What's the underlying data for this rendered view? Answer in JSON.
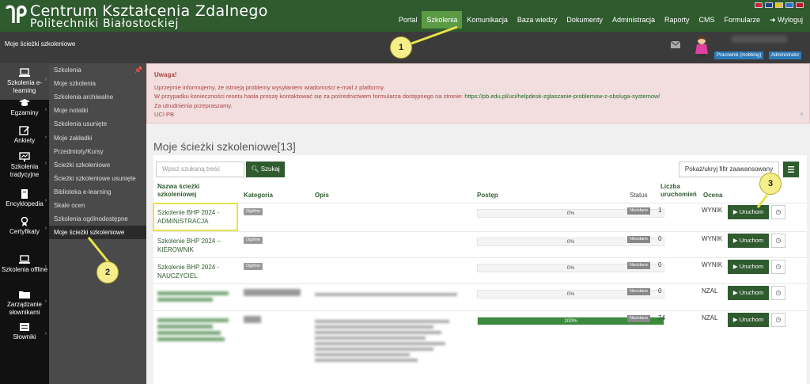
{
  "header": {
    "brand_line1": "Centrum Kształcenia Zdalnego",
    "brand_line2": "Politechniki Białostockiej",
    "nav": [
      "Portal",
      "Szkolenia",
      "Komunikacja",
      "Baza wiedzy",
      "Dokumenty",
      "Administracja",
      "Raporty",
      "CMS",
      "Formularze",
      "Wyloguj"
    ],
    "active_nav": "Szkolenia",
    "flags": [
      "#d4213d",
      "#1f3e8c",
      "#e8c02a",
      "#2f6fd0",
      "#c8102e"
    ]
  },
  "subheader": {
    "breadcrumb": "Moje ścieżki szkoleniowe",
    "badges": [
      "Pracownik (mobbing)",
      "Administrator"
    ]
  },
  "left_sidebar": [
    {
      "label": "Szkolenia e-learning",
      "icon": "laptop-icon"
    },
    {
      "label": "Egzaminy",
      "icon": "graduation-cap-icon"
    },
    {
      "label": "Ankiety",
      "icon": "pencil-square-icon"
    },
    {
      "label": "Szkolenia tradycyjne",
      "icon": "presentation-icon"
    },
    {
      "label": "Encyklopedia",
      "icon": "book-icon"
    },
    {
      "label": "Certyfikaty",
      "icon": "certificate-icon"
    },
    {
      "label": "Szkolenia offline",
      "icon": "laptop-offline-icon"
    },
    {
      "label": "Zarządzanie słownikami",
      "icon": "folder-icon"
    },
    {
      "label": "Słowniki",
      "icon": "dictionary-icon"
    }
  ],
  "sub_sidebar": [
    "Szkolenia",
    "Moje szkolenia",
    "Szkolenia archiwalne",
    "Moje notatki",
    "Szkolenia usunięte",
    "Moje zakładki",
    "Przedmioty/Kursy",
    "Ścieżki szkoleniowe",
    "Ścieżki szkoleniowe usunięte",
    "Biblioteka e-learning",
    "Skale ocen",
    "Szkolenia ogólnodostępne",
    "Moje ścieżki szkoleniowe"
  ],
  "alert": {
    "title": "Uwaga!",
    "line1": "Uprzejmie informujemy, że istnieją problemy wysyłaniem wiadomości e-mail z platformy.",
    "line2_prefix": "W przypadku konieczności resetu hasła proszę kontaktować się za pośrednictwem formularza dostępnego na stronie:",
    "line2_link": "https://pb.edu.pl/uci/helpdesk-zglaszanie-problemow-z-obsluga-systemow/",
    "line3": "Za utrudnienia przepraszamy.",
    "line4": "UCI PB",
    "close": "×"
  },
  "main": {
    "title": "Moje ścieżki szkoleniowe[13]",
    "search_placeholder": "Wpisz szukaną treść",
    "search_button": "Szukaj",
    "filter_button": "Pokaż/ukryj filtr zaawansowany",
    "columns": {
      "name": "Nazwa ścieżki szkoleniowej",
      "category": "Kategoria",
      "description": "Opis",
      "progress": "Postęp",
      "status": "Status",
      "runs": "Liczba uruchomień",
      "grade": "Ocena"
    },
    "rows": [
      {
        "name": "Szkolenie BHP 2024 - ADMINISTRACJA",
        "category": "Ogólne",
        "progress_label": "0%",
        "progress": 0,
        "status": "Nieżdane",
        "runs": "1",
        "grade": "WYNIK",
        "run_button": "Uruchom"
      },
      {
        "name": "Szkolenie BHP 2024 – KIEROWNIK",
        "category": "Ogólne",
        "progress_label": "0%",
        "progress": 0,
        "status": "Nieżdane",
        "runs": "0",
        "grade": "WYNIK",
        "run_button": "Uruchom"
      },
      {
        "name": "Szkolenie BHP 2024 - NAUCZYCIEL",
        "category": "Ogólne",
        "progress_label": "0%",
        "progress": 0,
        "status": "Nieżdane",
        "runs": "0",
        "grade": "WYNIK",
        "run_button": "Uruchom"
      },
      {
        "name": "",
        "category": "",
        "progress_label": "0%",
        "progress": 0,
        "status": "Nieżdane",
        "runs": "0",
        "grade": "NZAL",
        "run_button": "Uruchom"
      },
      {
        "name": "",
        "category": "",
        "progress_label": "100%",
        "progress": 100,
        "status": "Nieżdane",
        "runs": "74",
        "grade": "NZAL",
        "run_button": "Uruchom"
      }
    ]
  },
  "callouts": [
    "1",
    "2",
    "3"
  ]
}
